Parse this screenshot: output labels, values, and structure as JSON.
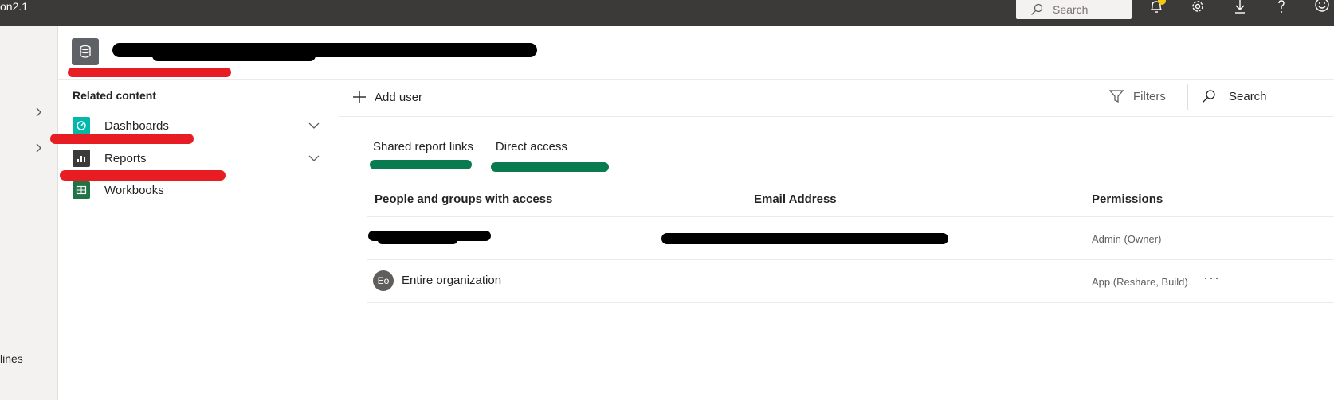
{
  "topbar": {
    "app_title": "on2.1",
    "search_placeholder": "Search",
    "icons": [
      "bell-icon",
      "gear-icon",
      "download-icon",
      "help-icon",
      "smiley-icon"
    ],
    "badge_color": "#f2c811"
  },
  "left_rail": {
    "bottom_label": "lines"
  },
  "header": {
    "dataset_icon": "database-icon"
  },
  "related": {
    "title": "Related content",
    "items": [
      {
        "label": "Dashboards",
        "icon": "dashboard-icon",
        "color": "#01b8aa"
      },
      {
        "label": "Reports",
        "icon": "report-icon",
        "color": "#3b3a39"
      },
      {
        "label": "Workbooks",
        "icon": "excel-workbook-icon",
        "color": "#217346"
      }
    ]
  },
  "toolbar": {
    "add_user": "Add user",
    "filters": "Filters",
    "search": "Search"
  },
  "tabs": [
    {
      "label": "Shared report links",
      "active": false
    },
    {
      "label": "Direct access",
      "active": true
    }
  ],
  "table": {
    "headers": [
      "People and groups with access",
      "Email Address",
      "Permissions"
    ],
    "rows": [
      {
        "name": "",
        "email": "",
        "permission": "Admin (Owner)"
      },
      {
        "name": "Entire organization",
        "initials": "Eo",
        "email": "",
        "permission": "App (Reshare, Build)",
        "more": "···"
      }
    ]
  }
}
